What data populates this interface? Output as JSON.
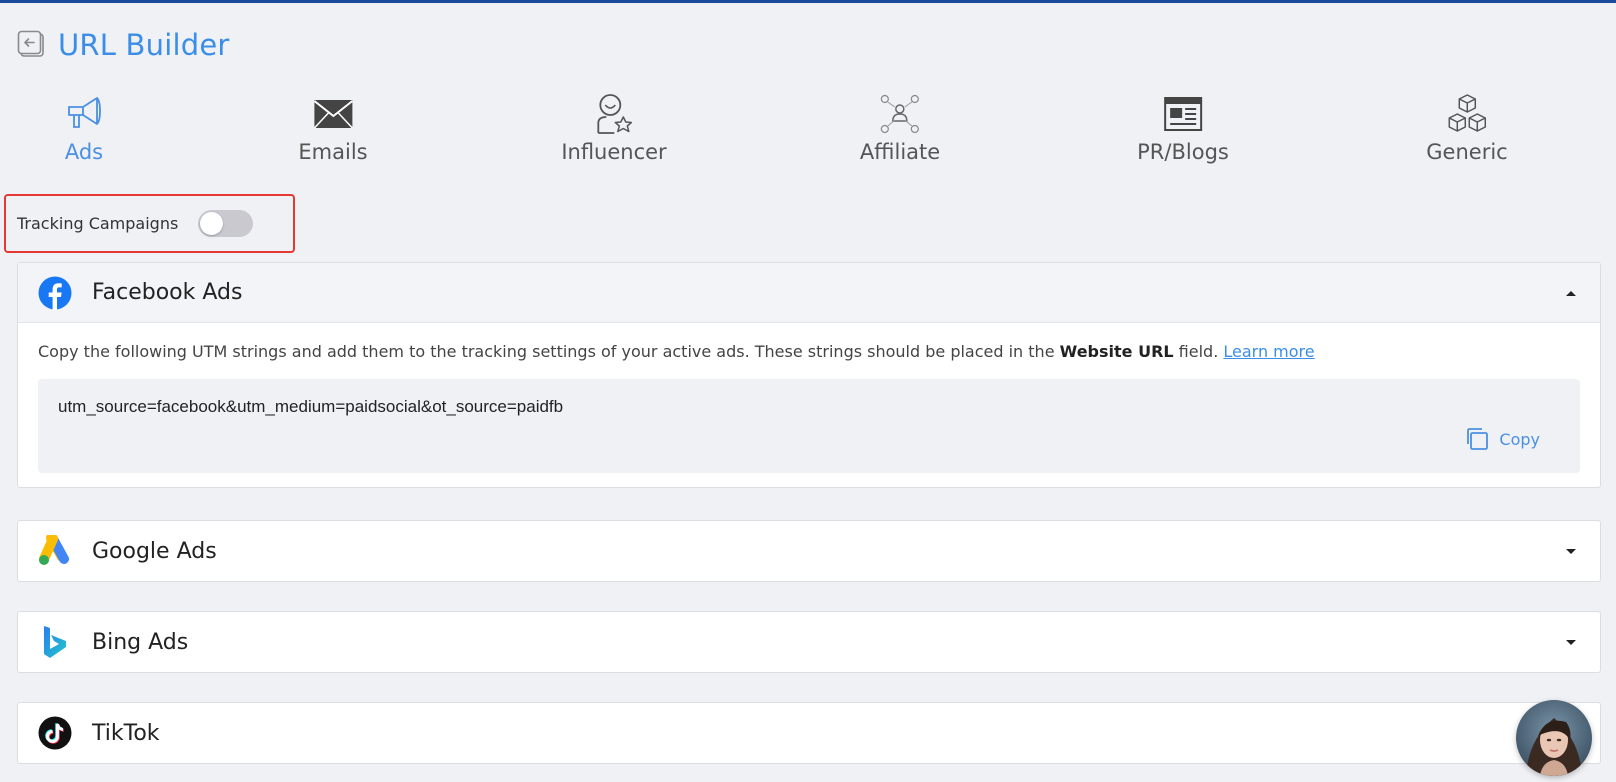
{
  "header": {
    "title": "URL Builder"
  },
  "tabs": [
    {
      "label": "Ads",
      "icon": "megaphone-icon",
      "active": true
    },
    {
      "label": "Emails",
      "icon": "envelope-icon"
    },
    {
      "label": "Influencer",
      "icon": "influencer-icon"
    },
    {
      "label": "Affiliate",
      "icon": "affiliate-network-icon"
    },
    {
      "label": "PR/Blogs",
      "icon": "newspaper-icon"
    },
    {
      "label": "Generic",
      "icon": "cubes-icon"
    }
  ],
  "tracking": {
    "label": "Tracking Campaigns",
    "enabled": false
  },
  "panels": [
    {
      "title": "Facebook Ads",
      "icon": "facebook-icon",
      "expanded": true,
      "description_pre": "Copy the following UTM strings and add them to the tracking settings of your active ads. These strings should be placed in the ",
      "description_bold": "Website URL",
      "description_post": " field. ",
      "learn_more": "Learn more",
      "utm_string": "utm_source=facebook&utm_medium=paidsocial&ot_source=paidfb",
      "copy_label": "Copy"
    },
    {
      "title": "Google Ads",
      "icon": "google-ads-icon",
      "expanded": false
    },
    {
      "title": "Bing Ads",
      "icon": "bing-icon",
      "expanded": false
    },
    {
      "title": "TikTok",
      "icon": "tiktok-icon",
      "expanded": false
    }
  ],
  "colors": {
    "accent": "#3b8ee8",
    "topbar": "#1b4b9b",
    "highlight_border": "#e53935",
    "facebook": "#1877f2"
  }
}
